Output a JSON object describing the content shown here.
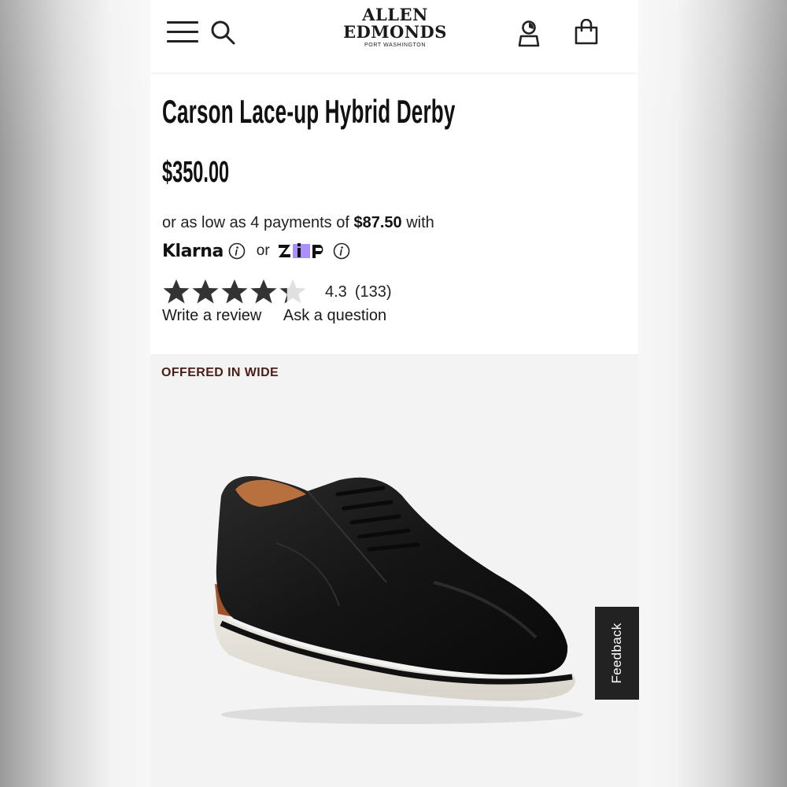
{
  "header": {
    "brand_line1": "ALLEN",
    "brand_line2": "EDMONDS",
    "brand_line3": "PORT WASHINGTON",
    "icons": [
      "menu-icon",
      "search-icon",
      "account-icon",
      "shopping-bag-icon"
    ]
  },
  "product": {
    "title": "Carson Lace-up Hybrid Derby",
    "price": "$350.00",
    "installments_prefix": "or as low as 4 payments of",
    "installments_amount": "$87.50",
    "installments_suffix": "with",
    "klarna_label": "Klarna",
    "or_label": "or",
    "zip_label": "zip",
    "rating_value": 4.3,
    "rating_text": "4.3",
    "review_count": "(133)",
    "write_review": "Write a review",
    "ask_question": "Ask a question",
    "badge": "OFFERED IN WIDE"
  },
  "feedback_label": "Feedback",
  "colors": {
    "star_filled": "#333333",
    "star_empty": "#e0e0e0",
    "badge": "#4a1f17",
    "zip_purple": "#aa8fff",
    "image_bg": "#f3f3f3",
    "feedback_bg": "#222222"
  }
}
